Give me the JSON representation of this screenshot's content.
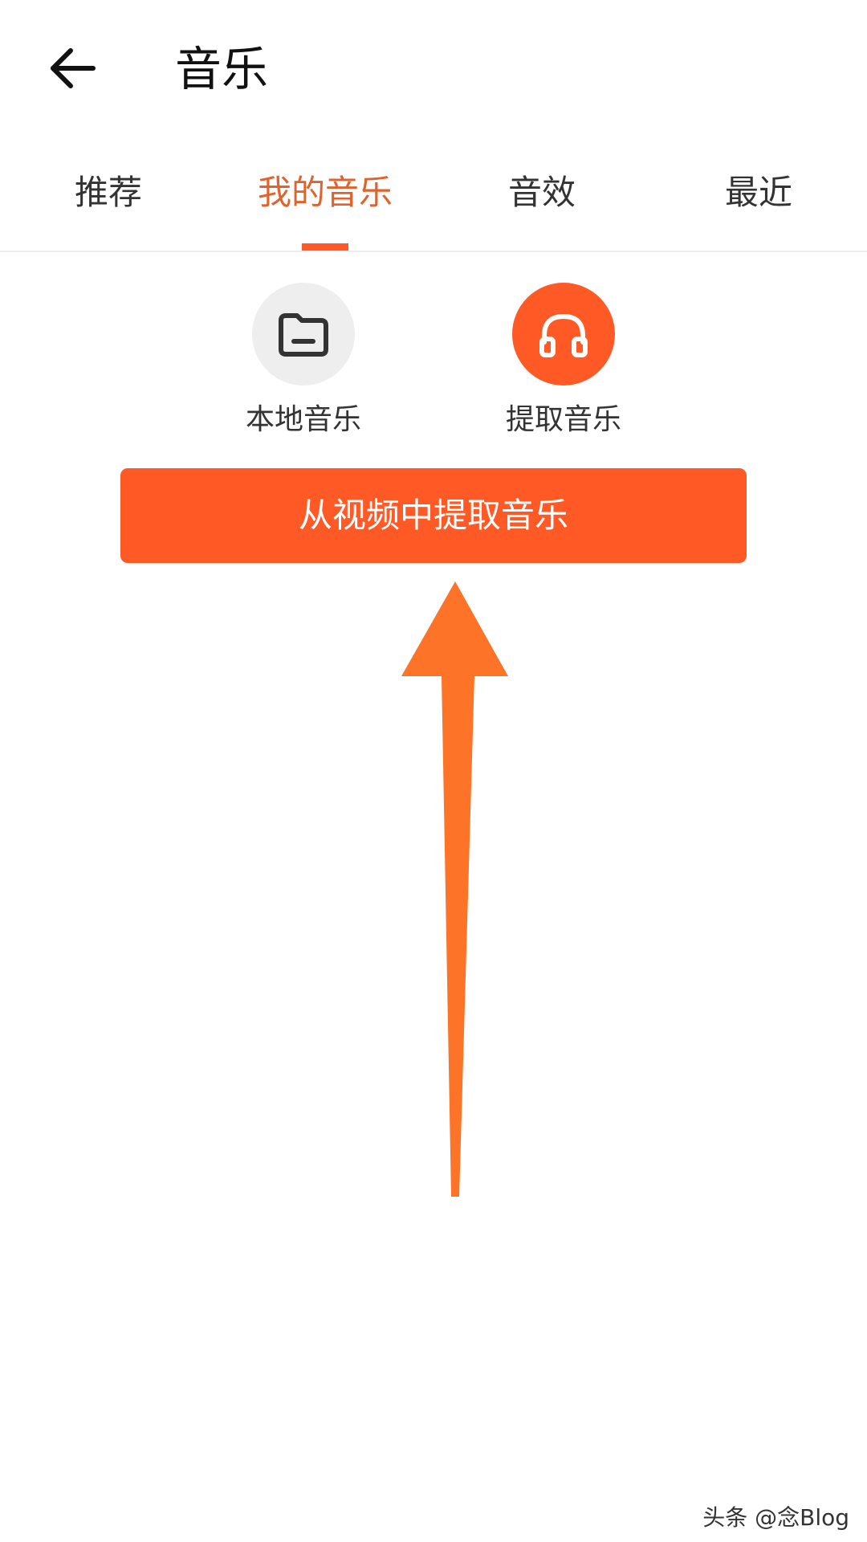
{
  "header": {
    "back_icon": "back-arrow-icon",
    "title": "音乐"
  },
  "tabs": [
    {
      "label": "推荐",
      "active": false
    },
    {
      "label": "我的音乐",
      "active": true
    },
    {
      "label": "音效",
      "active": false
    },
    {
      "label": "最近",
      "active": false
    }
  ],
  "options": [
    {
      "label": "本地音乐",
      "icon": "folder-icon"
    },
    {
      "label": "提取音乐",
      "icon": "headphones-icon"
    }
  ],
  "extract_button": {
    "label": "从视频中提取音乐"
  },
  "watermark": {
    "text": "头条 @念Blog"
  },
  "colors": {
    "accent": "#ff5a26",
    "active_tab_text": "#e0622c",
    "annotation_arrow": "#fd7327",
    "option_gray_bg": "#eeeeee"
  }
}
